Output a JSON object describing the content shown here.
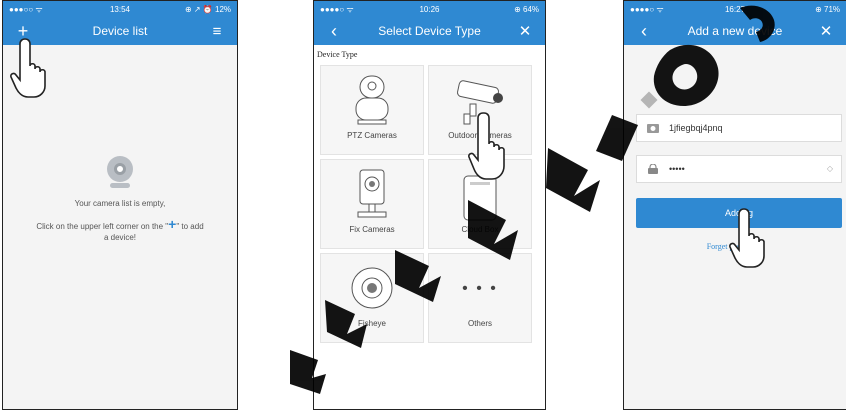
{
  "panel1": {
    "status": {
      "left": "●●●○○  ᯤ",
      "time": "13:54",
      "right": "⊕ ↗ ⏰ 12%"
    },
    "title": "Device list",
    "add_glyph": "+",
    "menu_glyph": "≡",
    "empty_line1": "Your camera list is empty,",
    "empty_line2_a": "Click on the upper left corner on the \"",
    "plus": "+",
    "empty_line2_b": "\" to add",
    "empty_line3": "a device!"
  },
  "panel2": {
    "status": {
      "left": "●●●●○  ᯤ",
      "time": "10:26",
      "right": "⊕ 64%"
    },
    "title": "Select Device Type",
    "back_glyph": "‹",
    "close_glyph": "✕",
    "section": "Device Type",
    "tiles": [
      {
        "label": "PTZ Cameras"
      },
      {
        "label": "Outdoor Cameras"
      },
      {
        "label": "Fix Cameras"
      },
      {
        "label": "Cloud Box"
      },
      {
        "label": "Fisheye"
      },
      {
        "label": "Others",
        "glyph": "• • •"
      }
    ]
  },
  "panel3": {
    "status": {
      "left": "●●●●○  ᯤ",
      "time": "16:27",
      "right": "⊕ 71%"
    },
    "title": "Add a new device",
    "back_glyph": "‹",
    "close_glyph": "✕",
    "device_id": "1jfiegbqj4pnq",
    "password": "•••••",
    "eye_glyph": "◇",
    "button": "Adding",
    "forgot": "Forget password?"
  },
  "colors": {
    "accent": "#2f89d2",
    "watermark": "#000000"
  }
}
